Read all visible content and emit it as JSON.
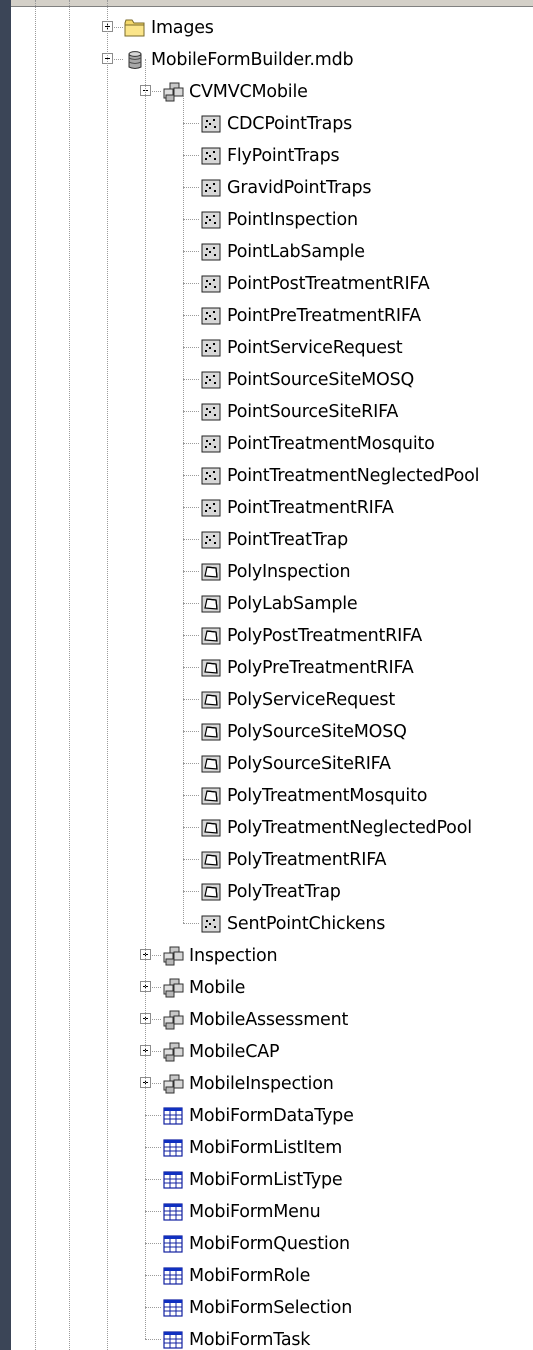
{
  "tree": {
    "images_folder": {
      "label": "Images",
      "icon": "folder-icon",
      "toggle": "plus"
    },
    "database": {
      "label": "MobileFormBuilder.mdb",
      "icon": "database-icon",
      "toggle": "minus"
    },
    "dataset": {
      "label": "CVMVCMobile",
      "icon": "feature-dataset-icon",
      "toggle": "minus",
      "feature_classes": [
        {
          "label": "CDCPointTraps",
          "type": "point"
        },
        {
          "label": "FlyPointTraps",
          "type": "point"
        },
        {
          "label": "GravidPointTraps",
          "type": "point"
        },
        {
          "label": "PointInspection",
          "type": "point"
        },
        {
          "label": "PointLabSample",
          "type": "point"
        },
        {
          "label": "PointPostTreatmentRIFA",
          "type": "point"
        },
        {
          "label": "PointPreTreatmentRIFA",
          "type": "point"
        },
        {
          "label": "PointServiceRequest",
          "type": "point"
        },
        {
          "label": "PointSourceSiteMOSQ",
          "type": "point"
        },
        {
          "label": "PointSourceSiteRIFA",
          "type": "point"
        },
        {
          "label": "PointTreatmentMosquito",
          "type": "point"
        },
        {
          "label": "PointTreatmentNeglectedPool",
          "type": "point"
        },
        {
          "label": "PointTreatmentRIFA",
          "type": "point"
        },
        {
          "label": "PointTreatTrap",
          "type": "point"
        },
        {
          "label": "PolyInspection",
          "type": "polygon"
        },
        {
          "label": "PolyLabSample",
          "type": "polygon"
        },
        {
          "label": "PolyPostTreatmentRIFA",
          "type": "polygon"
        },
        {
          "label": "PolyPreTreatmentRIFA",
          "type": "polygon"
        },
        {
          "label": "PolyServiceRequest",
          "type": "polygon"
        },
        {
          "label": "PolySourceSiteMOSQ",
          "type": "polygon"
        },
        {
          "label": "PolySourceSiteRIFA",
          "type": "polygon"
        },
        {
          "label": "PolyTreatmentMosquito",
          "type": "polygon"
        },
        {
          "label": "PolyTreatmentNeglectedPool",
          "type": "polygon"
        },
        {
          "label": "PolyTreatmentRIFA",
          "type": "polygon"
        },
        {
          "label": "PolyTreatTrap",
          "type": "polygon"
        },
        {
          "label": "SentPointChickens",
          "type": "point"
        }
      ]
    },
    "other_datasets": [
      {
        "label": "Inspection",
        "icon": "feature-dataset-icon",
        "toggle": "plus"
      },
      {
        "label": "Mobile",
        "icon": "feature-dataset-icon",
        "toggle": "plus"
      },
      {
        "label": "MobileAssessment",
        "icon": "feature-dataset-icon",
        "toggle": "plus"
      },
      {
        "label": "MobileCAP",
        "icon": "feature-dataset-icon",
        "toggle": "plus"
      },
      {
        "label": "MobileInspection",
        "icon": "feature-dataset-icon",
        "toggle": "plus"
      }
    ],
    "tables": [
      {
        "label": "MobiFormDataType",
        "icon": "table-icon"
      },
      {
        "label": "MobiFormListItem",
        "icon": "table-icon"
      },
      {
        "label": "MobiFormListType",
        "icon": "table-icon"
      },
      {
        "label": "MobiFormMenu",
        "icon": "table-icon"
      },
      {
        "label": "MobiFormQuestion",
        "icon": "table-icon"
      },
      {
        "label": "MobiFormRole",
        "icon": "table-icon"
      },
      {
        "label": "MobiFormSelection",
        "icon": "table-icon"
      },
      {
        "label": "MobiFormTask",
        "icon": "table-icon"
      }
    ]
  }
}
